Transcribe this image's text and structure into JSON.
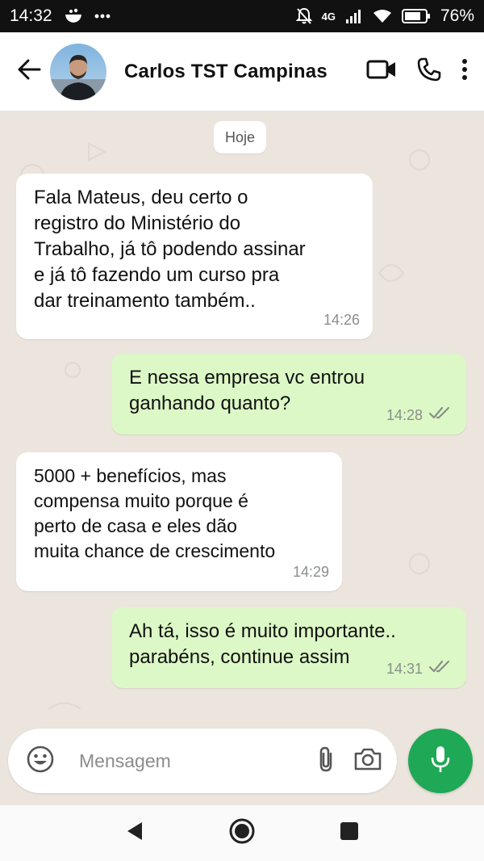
{
  "status_bar": {
    "time": "14:32",
    "network": "4G",
    "battery": "76%"
  },
  "header": {
    "contact_name": "Carlos TST Campinas"
  },
  "chat": {
    "date_chip": "Hoje",
    "messages": [
      {
        "direction": "incoming",
        "text": "Fala Mateus, deu certo o\nregistro do Ministério do\nTrabalho, já tô podendo assinar\ne já tô fazendo um curso pra\ndar treinamento também..",
        "time": "14:26"
      },
      {
        "direction": "outgoing",
        "text": "E nessa empresa vc entrou\nganhando quanto?",
        "time": "14:28",
        "status": "read"
      },
      {
        "direction": "incoming",
        "text": "5000 + benefícios, mas\ncompensa muito porque é\nperto de casa e eles dão\nmuita chance de crescimento",
        "time": "14:29"
      },
      {
        "direction": "outgoing",
        "text": "Ah tá, isso é muito importante..\nparabéns, continue assim",
        "time": "14:31",
        "status": "read"
      }
    ]
  },
  "composer": {
    "placeholder": "Mensagem"
  },
  "colors": {
    "outgoing_bubble": "#dcf8c6",
    "incoming_bubble": "#ffffff",
    "chat_background": "#ece5dd",
    "mic_button": "#1fa855"
  },
  "icons": [
    "back-arrow-icon",
    "video-call-icon",
    "phone-icon",
    "more-vert-icon",
    "emoji-icon",
    "attach-icon",
    "camera-icon",
    "mic-icon",
    "nav-back-icon",
    "nav-home-icon",
    "nav-recents-icon"
  ]
}
